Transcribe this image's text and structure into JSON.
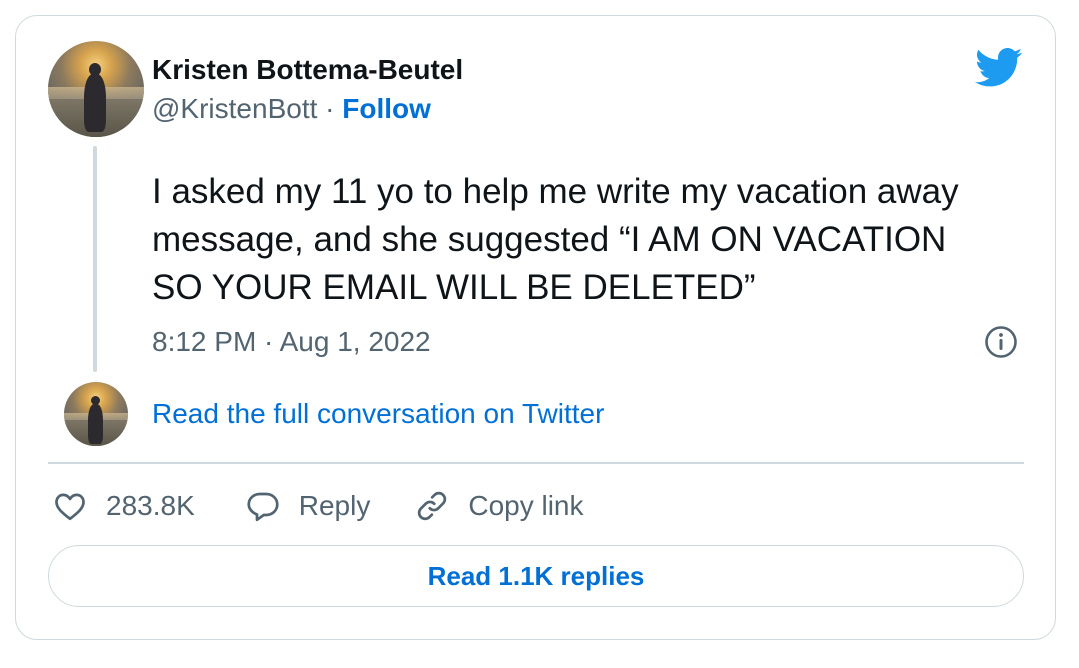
{
  "author": {
    "name": "Kristen Bottema-Beutel",
    "handle": "@KristenBott",
    "separator": "·",
    "follow_label": "Follow"
  },
  "tweet": {
    "text": "I asked my 11 yo to help me write my vacation away message, and she suggested “I AM ON VACATION SO YOUR EMAIL WILL BE DELETED”",
    "timestamp": "8:12 PM · Aug 1, 2022"
  },
  "conversation_link": "Read the full conversation on Twitter",
  "actions": {
    "like_count": "283.8K",
    "reply_label": "Reply",
    "copy_link_label": "Copy link"
  },
  "read_replies_label": "Read 1.1K replies",
  "icons": {
    "brand": "twitter-bird-icon",
    "info": "info-icon",
    "like": "heart-icon",
    "reply": "speech-bubble-icon",
    "copy": "link-icon"
  },
  "colors": {
    "brand_blue": "#1d9bf0",
    "link_blue": "#006fd6",
    "text": "#0f1419",
    "muted": "#536471",
    "border": "#cfd9de"
  }
}
